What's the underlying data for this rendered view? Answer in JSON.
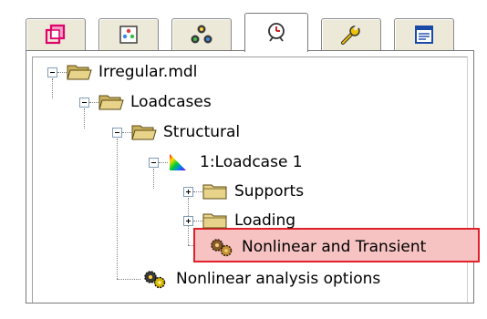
{
  "tabs": [
    {
      "icon": "layers-icon",
      "active": false
    },
    {
      "icon": "palette-icon",
      "active": false
    },
    {
      "icon": "nodes-icon",
      "active": false
    },
    {
      "icon": "clock-icon",
      "active": true
    },
    {
      "icon": "wrench-icon",
      "active": false
    },
    {
      "icon": "form-icon",
      "active": false
    }
  ],
  "tree": {
    "model": "Irregular.mdl",
    "loadcases": "Loadcases",
    "structural": "Structural",
    "loadcase1": "1:Loadcase 1",
    "supports": "Supports",
    "loading": "Loading",
    "nonlinear_transient": "Nonlinear and Transient",
    "nonlinear_options": "Nonlinear analysis options"
  },
  "colors": {
    "highlight_fill": "#f6c2c2",
    "highlight_border": "#e0202a",
    "folder": "#e8d38a"
  }
}
